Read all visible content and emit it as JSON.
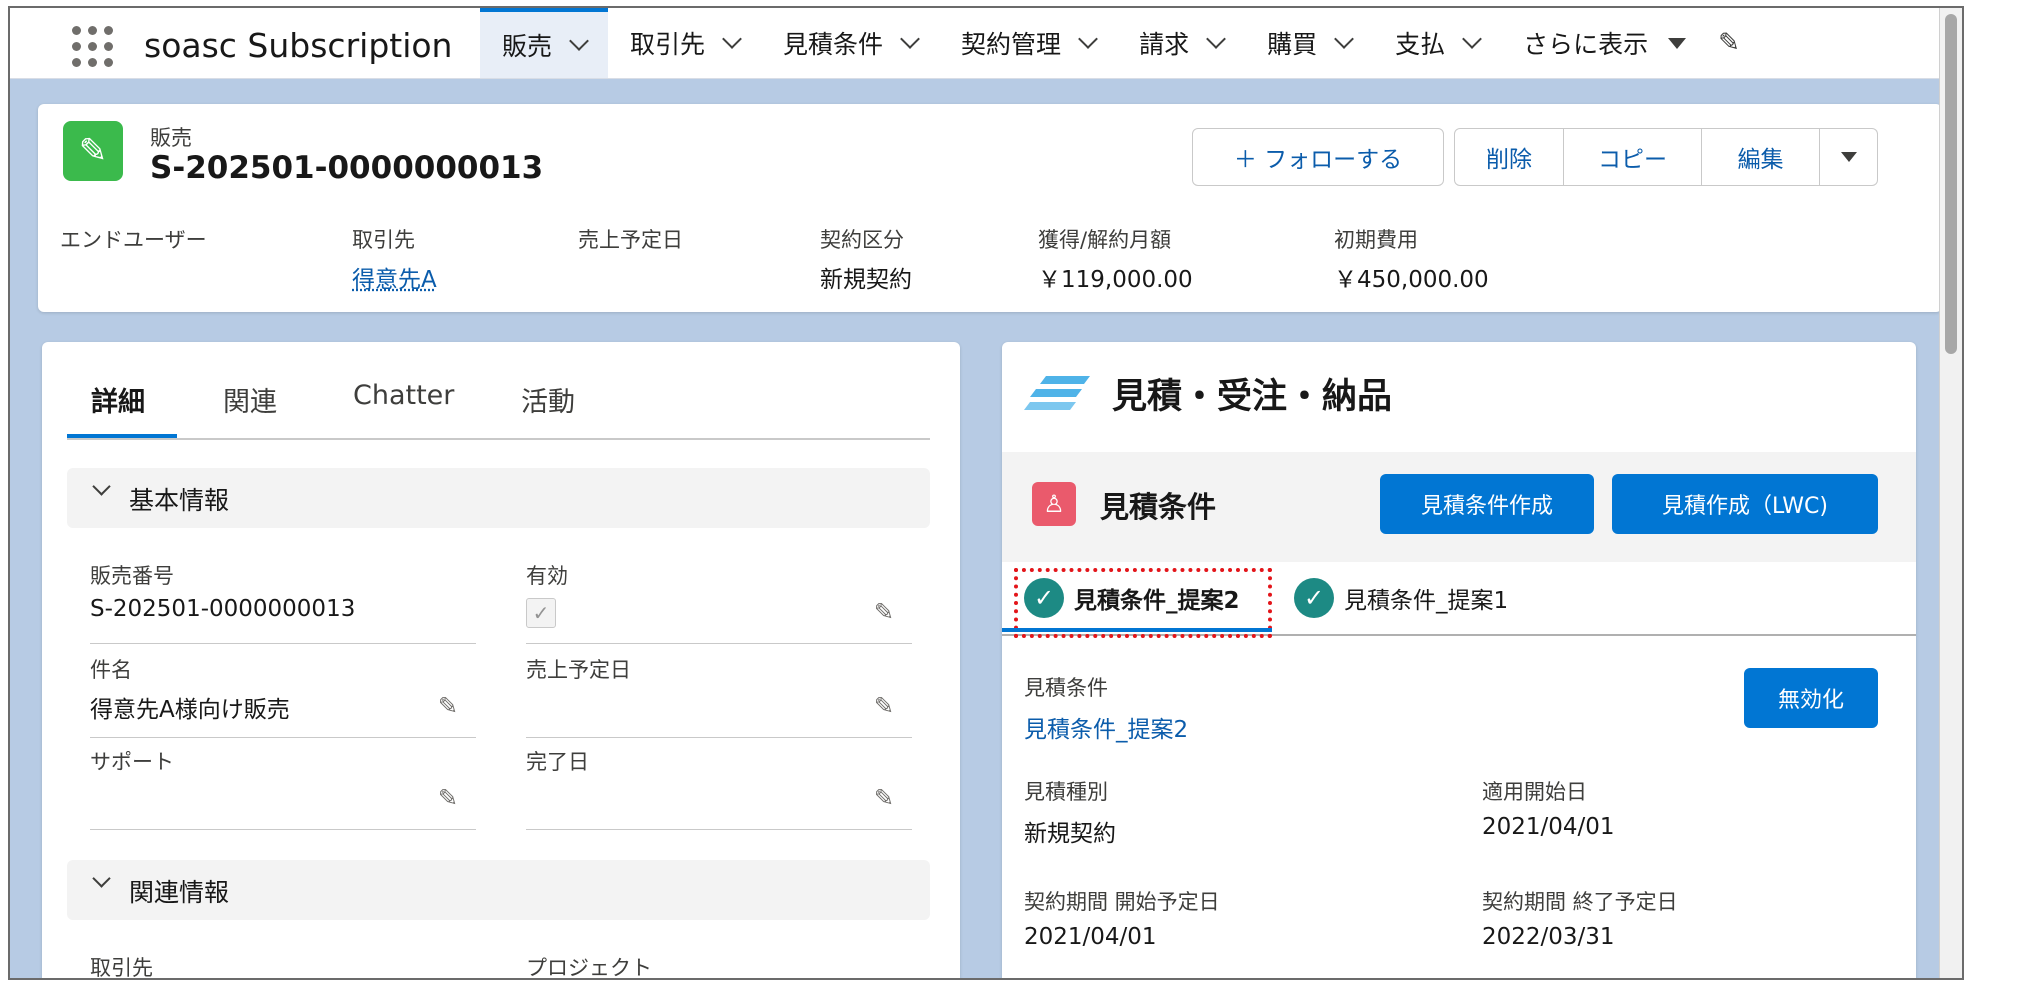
{
  "app": {
    "name": "soasc Subscription"
  },
  "nav": {
    "tabs": [
      {
        "label": "販売",
        "active": true
      },
      {
        "label": "取引先"
      },
      {
        "label": "見積条件"
      },
      {
        "label": "契約管理"
      },
      {
        "label": "請求"
      },
      {
        "label": "購買"
      },
      {
        "label": "支払"
      }
    ],
    "more_label": "さらに表示"
  },
  "record": {
    "type": "販売",
    "title": "S-202501-0000000013",
    "buttons": {
      "follow": "＋ フォローする",
      "delete": "削除",
      "copy": "コピー",
      "edit": "編集"
    },
    "fields": [
      {
        "label": "エンドユーザー",
        "value": ""
      },
      {
        "label": "取引先",
        "value": "得意先A"
      },
      {
        "label": "売上予定日",
        "value": ""
      },
      {
        "label": "契約区分",
        "value": "新規契約"
      },
      {
        "label": "獲得/解約月額",
        "value": "￥119,000.00"
      },
      {
        "label": "初期費用",
        "value": "￥450,000.00"
      }
    ]
  },
  "detail": {
    "tabs": [
      "詳細",
      "関連",
      "Chatter",
      "活動"
    ],
    "section1": "基本情報",
    "fields": [
      {
        "label": "販売番号",
        "value": "S-202501-0000000013"
      },
      {
        "label": "有効",
        "value": "✓"
      },
      {
        "label": "件名",
        "value": "得意先A様向け販売"
      },
      {
        "label": "売上予定日",
        "value": ""
      },
      {
        "label": "サポート",
        "value": ""
      },
      {
        "label": "完了日",
        "value": ""
      }
    ],
    "section2": "関連情報",
    "fields2": [
      {
        "label": "取引先"
      },
      {
        "label": "プロジェクト"
      }
    ]
  },
  "quote": {
    "title": "見積・受注・納品",
    "subtitle": "見積条件",
    "btn_create_condition": "見積条件作成",
    "btn_create_quote": "見積作成（LWC)",
    "tabs": [
      "見積条件_提案2",
      "見積条件_提案1"
    ],
    "disable_button": "無効化",
    "fields": [
      {
        "label": "見積条件",
        "value": "見積条件_提案2"
      },
      {
        "label": "見積種別",
        "value": "新規契約"
      },
      {
        "label": "適用開始日",
        "value": "2021/04/01"
      },
      {
        "label": "契約期間 開始予定日",
        "value": "2021/04/01"
      },
      {
        "label": "契約期間 終了予定日",
        "value": "2022/03/31"
      }
    ]
  }
}
